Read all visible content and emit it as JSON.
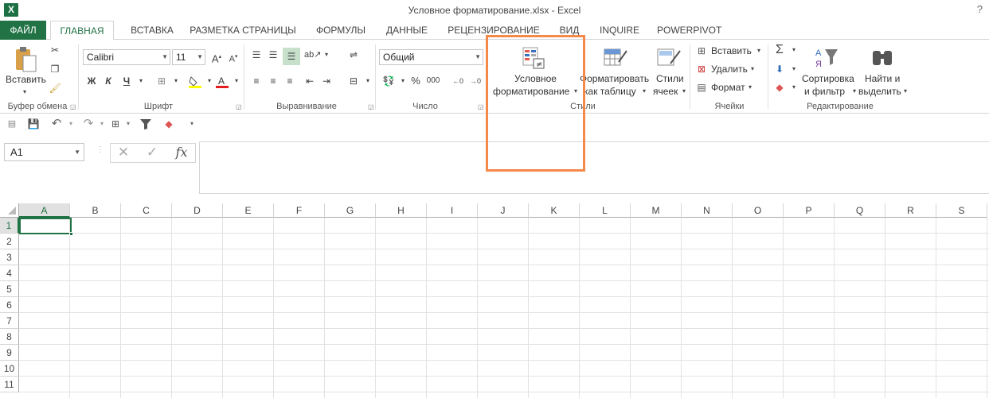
{
  "window": {
    "title": "Условное форматирование.xlsx - Excel",
    "app_icon": "excel-icon",
    "help": "?"
  },
  "tabs": [
    "ФАЙЛ",
    "ГЛАВНАЯ",
    "ВСТАВКА",
    "РАЗМЕТКА СТРАНИЦЫ",
    "ФОРМУЛЫ",
    "ДАННЫЕ",
    "РЕЦЕНЗИРОВАНИЕ",
    "ВИД",
    "INQUIRE",
    "POWERPIVOT"
  ],
  "ribbon": {
    "clipboard": {
      "paste": "Вставить",
      "group": "Буфер обмена"
    },
    "font": {
      "name": "Calibri",
      "size": "11",
      "bold": "Ж",
      "italic": "К",
      "underline": "Ч",
      "group": "Шрифт"
    },
    "alignment": {
      "group": "Выравнивание"
    },
    "number": {
      "format": "Общий",
      "percent": "%",
      "thousands": "000",
      "group": "Число"
    },
    "styles": {
      "conditional_line1": "Условное",
      "conditional_line2": "форматирование",
      "table_line1": "Форматировать",
      "table_line2": "как таблицу",
      "cell_styles_line1": "Стили",
      "cell_styles_line2": "ячеек",
      "group": "Стили"
    },
    "cells": {
      "insert": "Вставить",
      "delete": "Удалить",
      "format": "Формат",
      "group": "Ячейки"
    },
    "editing": {
      "sort_line1": "Сортировка",
      "sort_line2": "и фильтр",
      "find_line1": "Найти и",
      "find_line2": "выделить",
      "group": "Редактирование"
    }
  },
  "formula_bar": {
    "name_box": "A1",
    "fx": "fx",
    "value": ""
  },
  "grid": {
    "columns": [
      "A",
      "B",
      "C",
      "D",
      "E",
      "F",
      "G",
      "H",
      "I",
      "J",
      "K",
      "L",
      "M",
      "N",
      "O",
      "P",
      "Q",
      "R",
      "S"
    ],
    "rows": [
      "1",
      "2",
      "3",
      "4",
      "5",
      "6",
      "7",
      "8",
      "9",
      "10",
      "11"
    ],
    "selected_cell": "A1"
  },
  "colors": {
    "accent": "#217346",
    "highlight": "#f5894a"
  }
}
